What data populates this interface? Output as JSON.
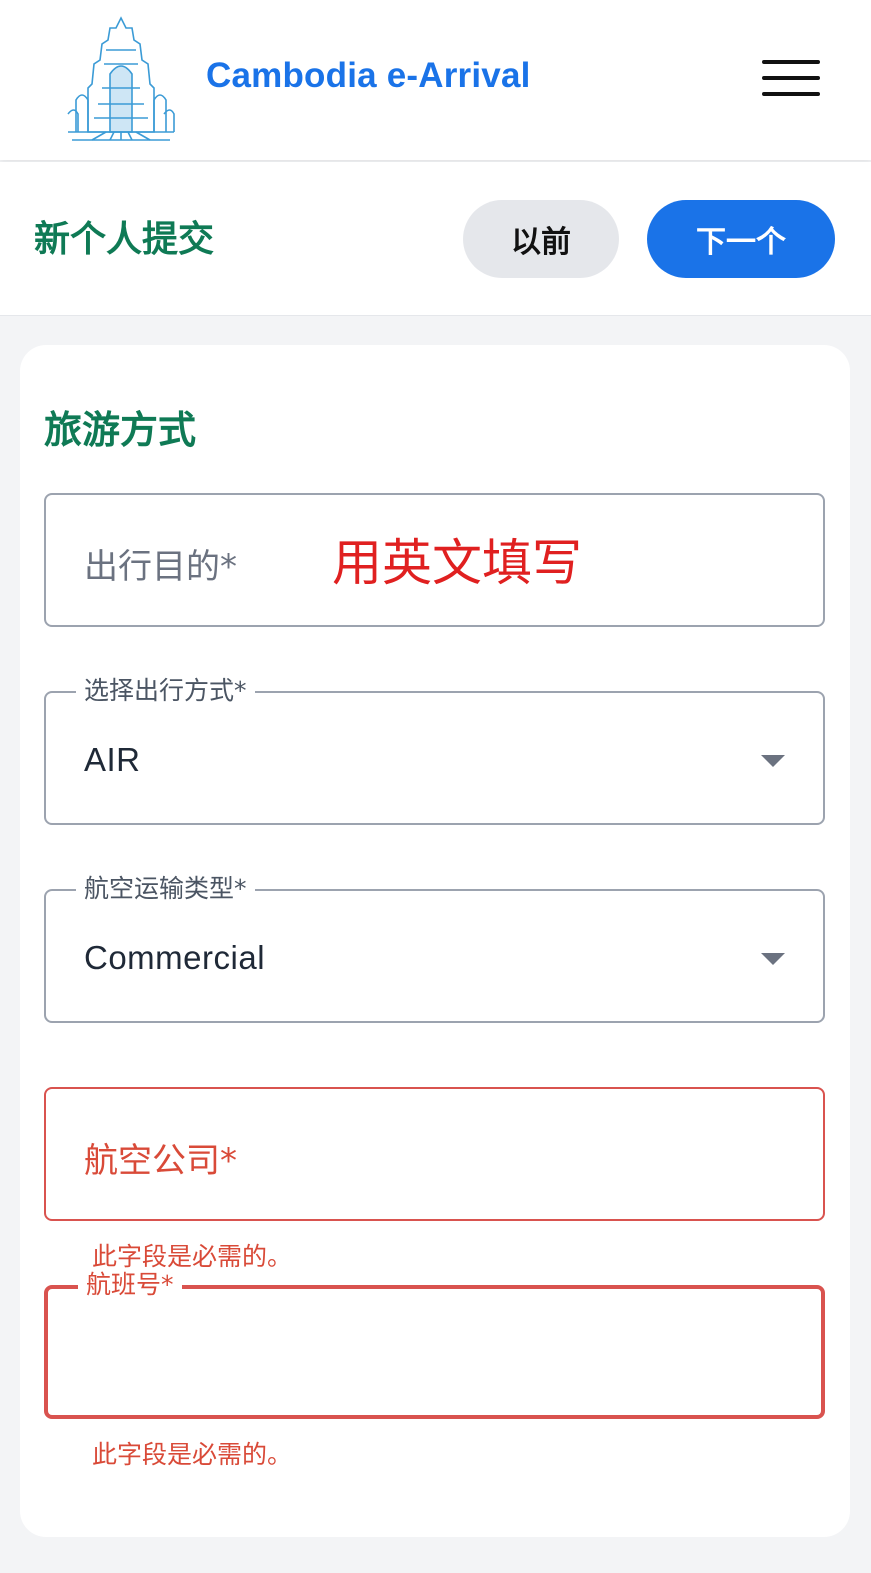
{
  "header": {
    "app_title": "Cambodia e-Arrival",
    "logo_icon": "angkor-temple-icon",
    "menu_icon": "hamburger-menu-icon"
  },
  "toolbar": {
    "title": "新个人提交",
    "prev_label": "以前",
    "next_label": "下一个"
  },
  "section": {
    "title": "旅游方式"
  },
  "fields": {
    "purpose": {
      "placeholder": "出行目的*",
      "annotation": "用英文填写"
    },
    "travel_mode": {
      "label": "选择出行方式*",
      "value": "AIR"
    },
    "air_transport_type": {
      "label": "航空运输类型*",
      "value": "Commercial"
    },
    "airline": {
      "placeholder": "航空公司*",
      "error": "此字段是必需的。"
    },
    "flight_number": {
      "label": "航班号*",
      "value": "",
      "error": "此字段是必需的。"
    }
  },
  "colors": {
    "brand_blue": "#1a73e8",
    "section_green": "#0f7a55",
    "error_red": "#d94a38",
    "annotation_red": "#e02020"
  }
}
